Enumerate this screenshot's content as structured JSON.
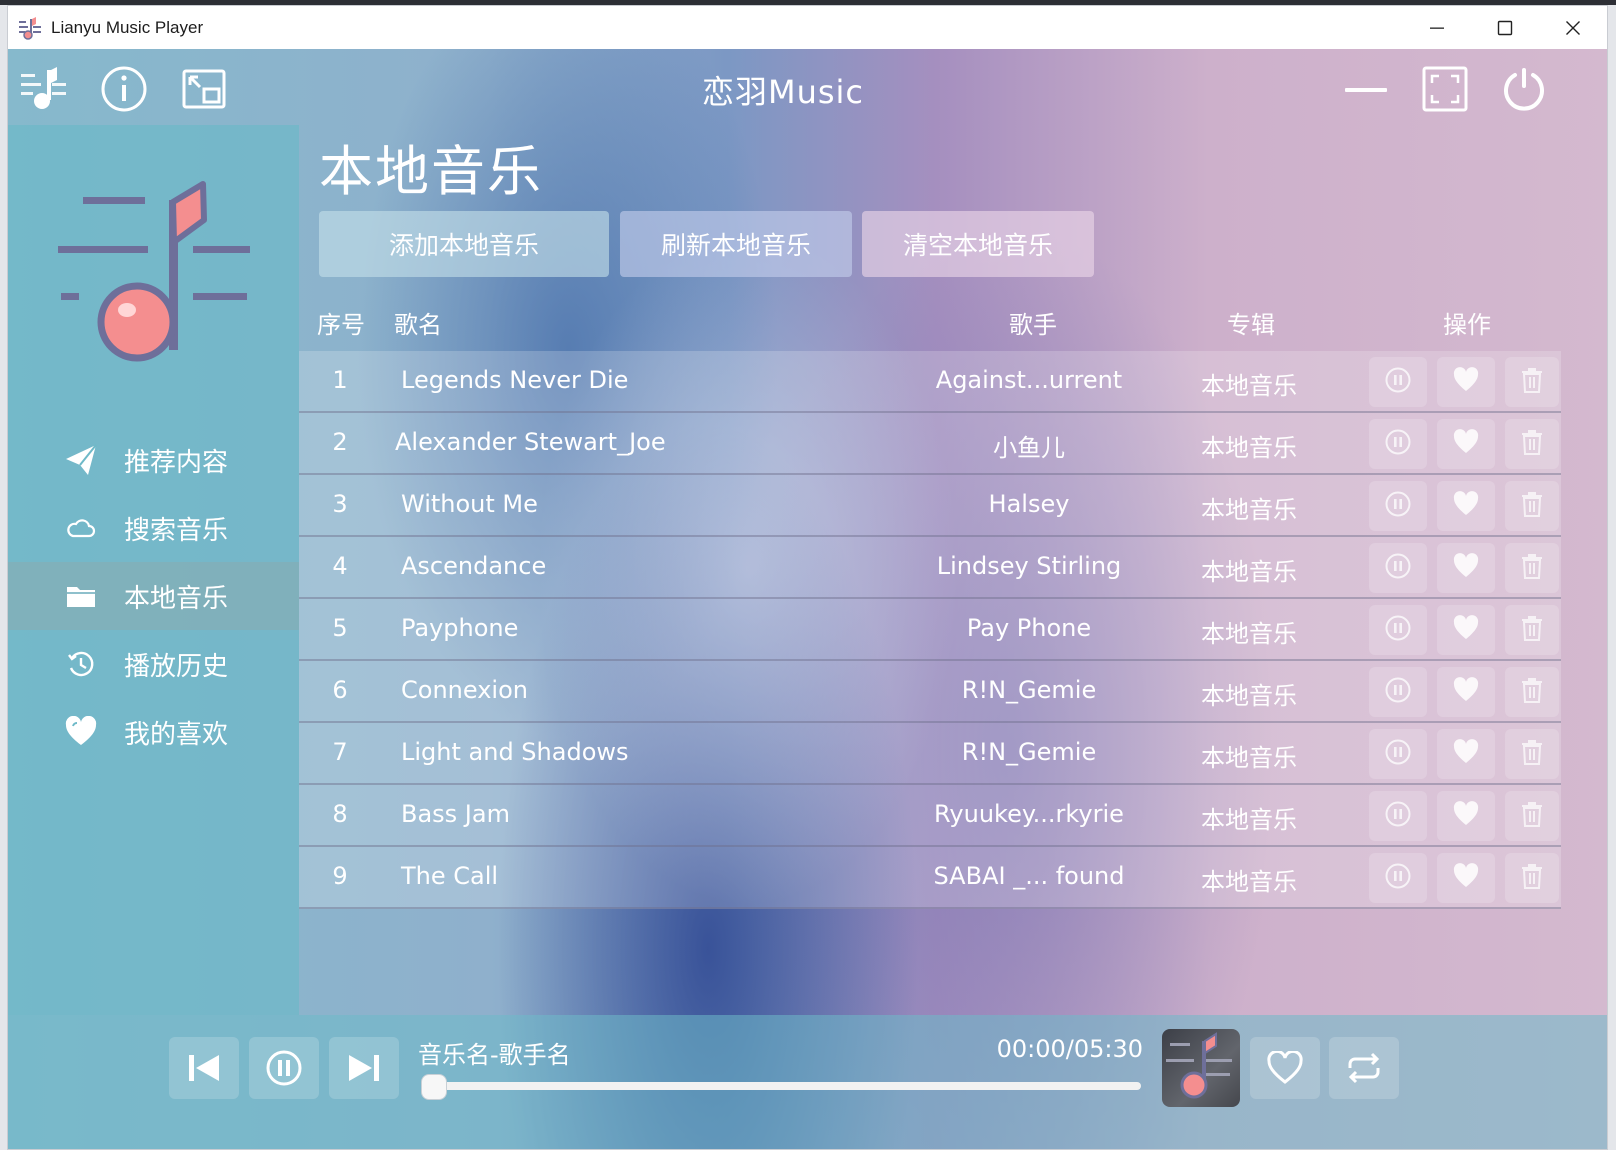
{
  "window": {
    "title": "Lianyu Music Player"
  },
  "app": {
    "title": "恋羽Music"
  },
  "sidebar": {
    "items": [
      {
        "label": "推荐内容",
        "icon": "paper-plane-icon"
      },
      {
        "label": "搜索音乐",
        "icon": "cloud-icon"
      },
      {
        "label": "本地音乐",
        "icon": "folder-icon",
        "active": true
      },
      {
        "label": "播放历史",
        "icon": "history-icon"
      },
      {
        "label": "我的喜欢",
        "icon": "heart-icon"
      }
    ]
  },
  "page": {
    "heading": "本地音乐",
    "actions": {
      "add": "添加本地音乐",
      "refresh": "刷新本地音乐",
      "clear": "清空本地音乐"
    }
  },
  "table": {
    "headers": {
      "index": "序号",
      "name": "歌名",
      "artist": "歌手",
      "album": "专辑",
      "ops": "操作"
    },
    "rows": [
      {
        "no": "1",
        "name": "Legends Never Die",
        "artist": "Against...urrent",
        "album": "本地音乐"
      },
      {
        "no": "2",
        "name": "Alexander Stewart_Joe",
        "artist": "小鱼儿",
        "album": "本地音乐"
      },
      {
        "no": "3",
        "name": "Without Me",
        "artist": "Halsey",
        "album": "本地音乐"
      },
      {
        "no": "4",
        "name": "Ascendance",
        "artist": "Lindsey Stirling",
        "album": "本地音乐"
      },
      {
        "no": "5",
        "name": "Payphone",
        "artist": "Pay Phone",
        "album": "本地音乐"
      },
      {
        "no": "6",
        "name": "Connexion",
        "artist": "R!N_Gemie",
        "album": "本地音乐"
      },
      {
        "no": "7",
        "name": "Light and Shadows",
        "artist": "R!N_Gemie",
        "album": "本地音乐"
      },
      {
        "no": "8",
        "name": "Bass Jam",
        "artist": "Ryuukey...rkyrie",
        "album": "本地音乐"
      },
      {
        "no": "9",
        "name": "The Call",
        "artist": "SABAI _... found",
        "album": "本地音乐"
      }
    ]
  },
  "player": {
    "song": "音乐名-歌手名",
    "time": "00:00/05:30",
    "progress": 0.0
  },
  "colors": {
    "logo_bar": "#6e6f9a",
    "logo_ball": "#f48e8f",
    "sidebar": "#6eb9c8"
  }
}
